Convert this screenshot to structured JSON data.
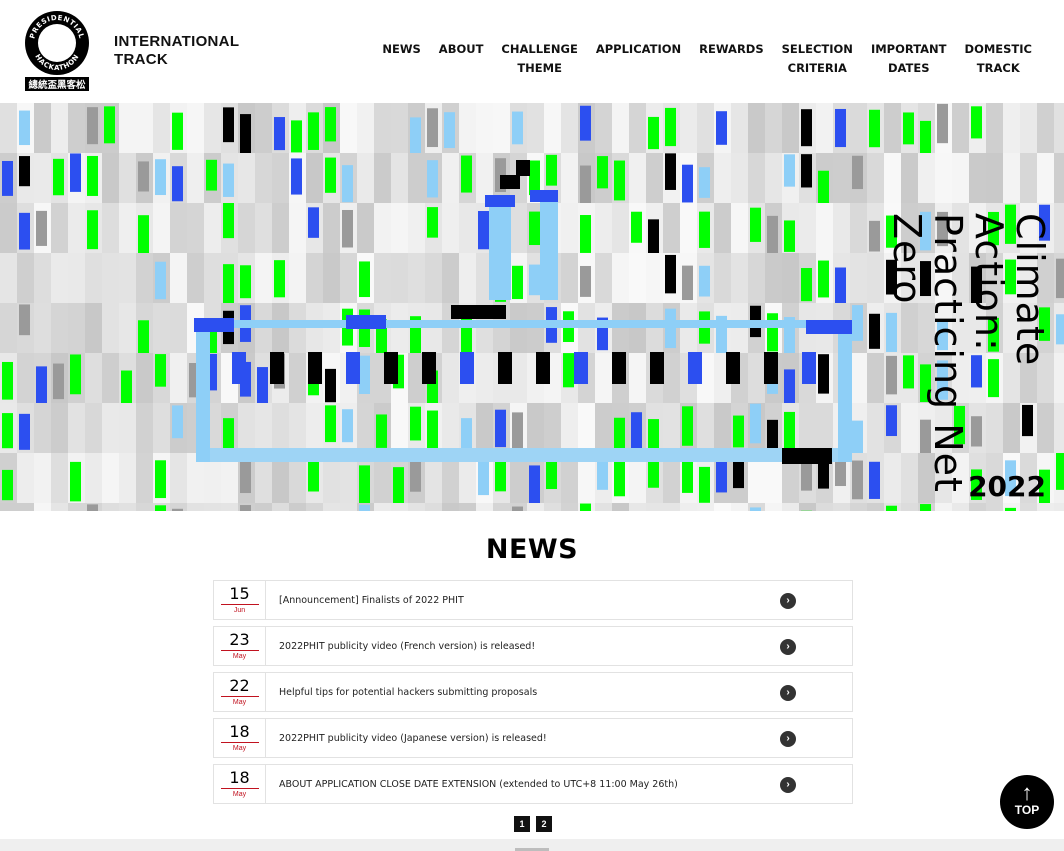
{
  "header": {
    "logo": {
      "ring_text_top": "PRESIDENTIAL",
      "ring_text_bottom": "HACKATHON",
      "banner_text": "總統盃黑客松"
    },
    "brand_line1": "INTERNATIONAL",
    "brand_line2": "TRACK",
    "nav": [
      {
        "label": "NEWS"
      },
      {
        "label": "ABOUT"
      },
      {
        "label": "CHALLENGE\nTHEME"
      },
      {
        "label": "APPLICATION"
      },
      {
        "label": "REWARDS"
      },
      {
        "label": "SELECTION\nCRITERIA"
      },
      {
        "label": "IMPORTANT\nDATES"
      },
      {
        "label": "DOMESTIC\nTRACK"
      }
    ]
  },
  "hero": {
    "title_line1": "Climate Action:",
    "title_line2": "Practicing Net Zero",
    "year": "2022",
    "colors": {
      "green": "#00ff00",
      "blue": "#2c4ff0",
      "light_blue": "#8ecff7",
      "black": "#000000"
    }
  },
  "news": {
    "heading": "NEWS",
    "items": [
      {
        "day": "15",
        "month": "Jun",
        "title": "[Announcement] Finalists of 2022 PHIT"
      },
      {
        "day": "23",
        "month": "May",
        "title": "2022PHIT publicity video (French version) is released!"
      },
      {
        "day": "22",
        "month": "May",
        "title": "Helpful tips for potential hackers submitting proposals"
      },
      {
        "day": "18",
        "month": "May",
        "title": "2022PHIT publicity video (Japanese version) is released!"
      },
      {
        "day": "18",
        "month": "May",
        "title": "ABOUT APPLICATION CLOSE DATE EXTENSION (extended to UTC+8 11:00 May 26th)"
      }
    ],
    "arrow_icon": "chevron-right-circle-icon",
    "pages": [
      "1",
      "2"
    ]
  },
  "back_to_top": {
    "label": "TOP",
    "icon": "arrow-up-icon"
  }
}
